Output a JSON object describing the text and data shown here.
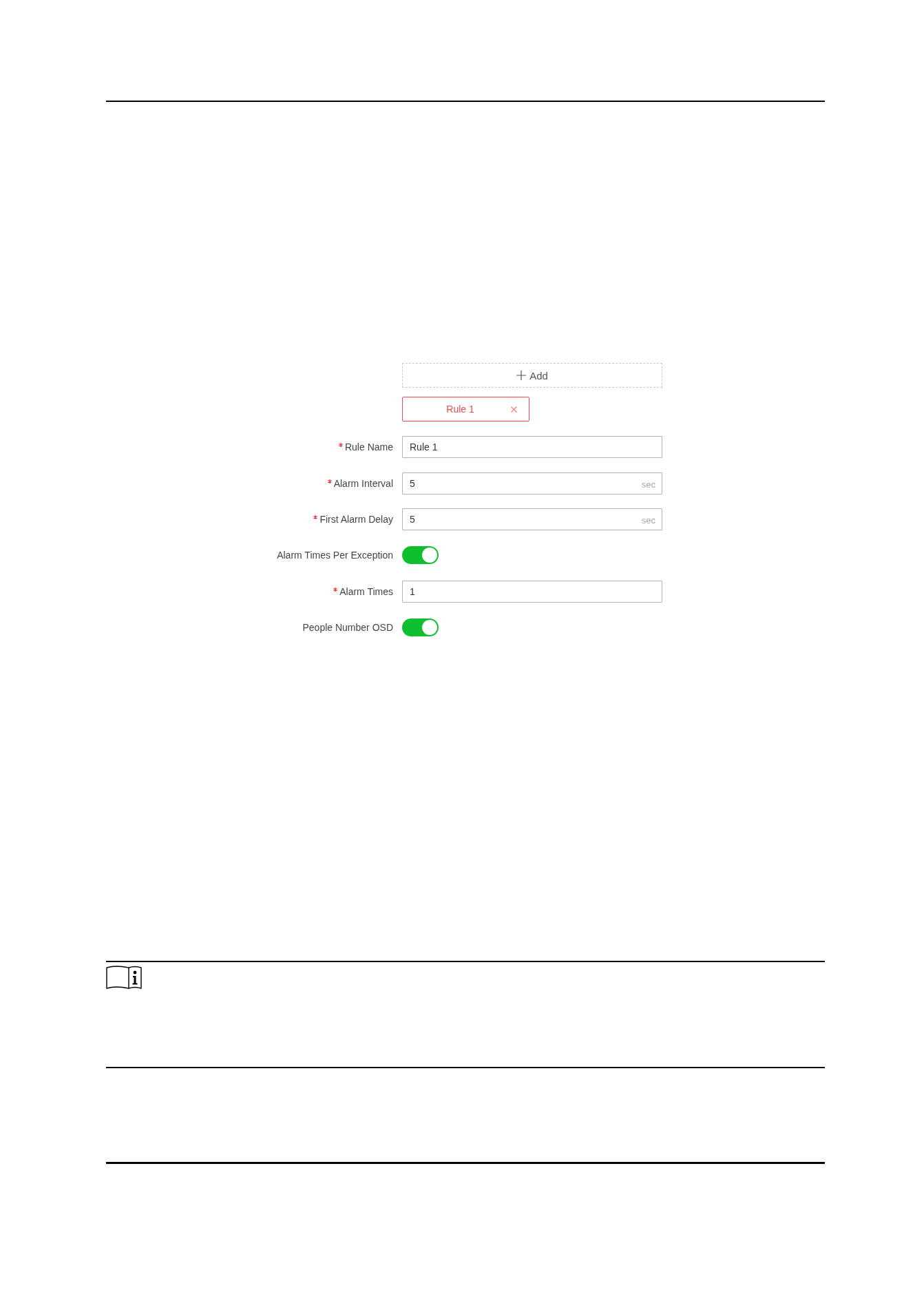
{
  "rule_list": {
    "add_button": {
      "label": "Add"
    },
    "tabs": [
      {
        "label": "Rule 1",
        "selected": true
      }
    ]
  },
  "fields": [
    {
      "kind": "text",
      "label": "Rule Name",
      "required": true,
      "value": "Rule 1"
    },
    {
      "kind": "text",
      "label": "Alarm Interval",
      "required": true,
      "value": "5",
      "unit": "sec"
    },
    {
      "kind": "text",
      "label": "First Alarm Delay",
      "required": true,
      "value": "5",
      "unit": "sec"
    },
    {
      "kind": "toggle",
      "label": "Alarm Times Per Exception",
      "required": false,
      "on": true
    },
    {
      "kind": "text",
      "label": "Alarm Times",
      "required": true,
      "value": "1"
    },
    {
      "kind": "toggle",
      "label": "People Number OSD",
      "required": false,
      "on": true
    }
  ]
}
